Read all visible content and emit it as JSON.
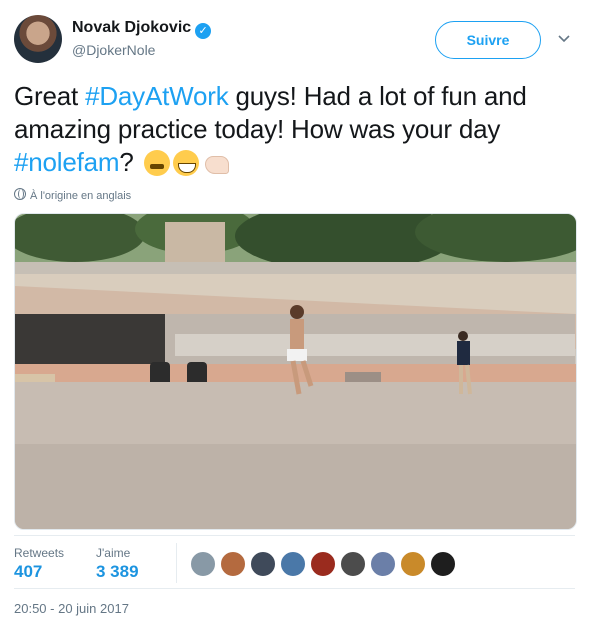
{
  "author": {
    "name": "Novak Djokovic",
    "handle": "@DjokerNole",
    "verified": true
  },
  "follow_label": "Suivre",
  "tweet": {
    "part1": "Great ",
    "hashtag1": "#DayAtWork",
    "part2": " guys! Had a lot of fun and amazing practice today! How was your day ",
    "hashtag2": "#nolefam",
    "part3": "?"
  },
  "translation_note": "À l'origine en anglais",
  "stats": {
    "retweets_label": "Retweets",
    "retweets_value": "407",
    "likes_label": "J'aime",
    "likes_value": "3 389"
  },
  "timestamp": "20:50 - 20 juin 2017",
  "colors": {
    "accent": "#1da1f2",
    "stat_value": "#1c94e0",
    "muted": "#657786"
  },
  "icons": [
    "verified-badge-icon",
    "chevron-down-icon",
    "globe-icon",
    "face-with-steam-emoji",
    "grinning-face-emoji",
    "flexed-biceps-emoji"
  ]
}
